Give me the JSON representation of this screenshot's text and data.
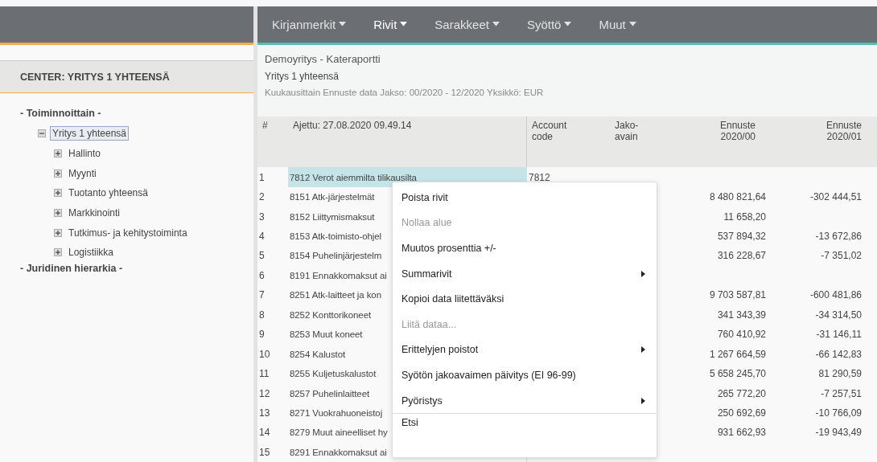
{
  "sidebar": {
    "title": "CENTER: YRITYS 1 YHTEENSÄ",
    "groups": [
      {
        "label": "- Toiminnoittain -",
        "tree": [
          {
            "label": "Yritys 1 yhteensä",
            "expanded": true,
            "selected": true,
            "children": [
              {
                "label": "Hallinto",
                "expanded": false,
                "selected": false
              },
              {
                "label": "Myynti",
                "expanded": false,
                "selected": false
              },
              {
                "label": "Tuotanto yhteensä",
                "expanded": false,
                "selected": false
              },
              {
                "label": "Markkinointi",
                "expanded": false,
                "selected": false
              },
              {
                "label": "Tutkimus- ja kehitystoiminta",
                "expanded": false,
                "selected": false
              },
              {
                "label": "Logistiikka",
                "expanded": false,
                "selected": false
              }
            ]
          }
        ]
      },
      {
        "label": "- Juridinen hierarkia -"
      }
    ]
  },
  "menu_bar": [
    {
      "label": "Kirjanmerkit",
      "selected": false
    },
    {
      "label": "Rivit",
      "selected": true
    },
    {
      "label": "Sarakkeet",
      "selected": false
    },
    {
      "label": "Syöttö",
      "selected": false
    },
    {
      "label": "Muut",
      "selected": false
    }
  ],
  "report": {
    "title": "Demoyritys - Kateraportti",
    "subtitle": "Yritys 1 yhteensä",
    "details": "Kuukausittain Ennuste data Jakso: 00/2020 - 12/2020 Yksikkö: EUR"
  },
  "table": {
    "columns": [
      "#",
      "Ajettu: 27.08.2020 09.49.14",
      "Account\ncode",
      "Jako-\navain",
      "Ennuste\n2020/00",
      "Ennuste\n2020/01"
    ],
    "rows": [
      {
        "num": "1",
        "name": "7812 Verot aiemmilta tilikausilta",
        "code": "7812",
        "v0": "",
        "v1": "",
        "selected": true
      },
      {
        "num": "2",
        "name": "8151 Atk-järjestelmät",
        "code": "",
        "v0": "8 480 821,64",
        "v1": "-302 444,51",
        "selected": false
      },
      {
        "num": "3",
        "name": "8152 Liittymismaksut",
        "code": "",
        "v0": "11 658,20",
        "v1": "",
        "selected": false
      },
      {
        "num": "4",
        "name": "8153 Atk-toimisto-ohjel",
        "code": "",
        "v0": "537 894,32",
        "v1": "-13 672,86",
        "selected": false
      },
      {
        "num": "5",
        "name": "8154 Puhelinjärjestelm",
        "code": "",
        "v0": "316 228,67",
        "v1": "-7 351,02",
        "selected": false
      },
      {
        "num": "6",
        "name": "8191 Ennakkomaksut ai",
        "code": "",
        "v0": "",
        "v1": "",
        "selected": false
      },
      {
        "num": "7",
        "name": "8251 Atk-laitteet ja kon",
        "code": "",
        "v0": "9 703 587,81",
        "v1": "-600 481,86",
        "selected": false
      },
      {
        "num": "8",
        "name": "8252 Konttorikoneet",
        "code": "",
        "v0": "341 343,39",
        "v1": "-34 314,50",
        "selected": false
      },
      {
        "num": "9",
        "name": "8253 Muut koneet",
        "code": "",
        "v0": "760 410,92",
        "v1": "-31 146,11",
        "selected": false
      },
      {
        "num": "10",
        "name": "8254 Kalustot",
        "code": "",
        "v0": "1 267 664,59",
        "v1": "-66 142,83",
        "selected": false
      },
      {
        "num": "11",
        "name": "8255 Kuljetuskalustot",
        "code": "",
        "v0": "5 658 245,70",
        "v1": "81 290,59",
        "selected": false
      },
      {
        "num": "12",
        "name": "8257 Puhelinlaitteet",
        "code": "",
        "v0": "265 772,20",
        "v1": "-7 257,51",
        "selected": false
      },
      {
        "num": "13",
        "name": "8271 Vuokrahuoneistoj",
        "code": "",
        "v0": "250 692,69",
        "v1": "-10 766,09",
        "selected": false
      },
      {
        "num": "14",
        "name": "8279 Muut aineelliset hy",
        "code": "",
        "v0": "931 662,93",
        "v1": "-19 943,49",
        "selected": false
      },
      {
        "num": "15",
        "name": "8291 Ennakkomaksut ai",
        "code": "",
        "v0": "",
        "v1": "",
        "selected": false
      }
    ]
  },
  "context_menu": [
    {
      "label": "Poista rivit",
      "disabled": false,
      "submenu": false,
      "divider_before": false
    },
    {
      "label": "Nollaa alue",
      "disabled": true,
      "submenu": false,
      "divider_before": false
    },
    {
      "label": "Muutos prosenttia +/-",
      "disabled": false,
      "submenu": false,
      "divider_before": false
    },
    {
      "label": "Summarivit",
      "disabled": false,
      "submenu": true,
      "divider_before": false
    },
    {
      "label": "Kopioi data liitettäväksi",
      "disabled": false,
      "submenu": false,
      "divider_before": false
    },
    {
      "label": "Liitä dataa...",
      "disabled": true,
      "submenu": false,
      "divider_before": false
    },
    {
      "label": "Erittelyjen poistot",
      "disabled": false,
      "submenu": true,
      "divider_before": false
    },
    {
      "label": "Syötön jakoavaimen päivitys (EI 96-99)",
      "disabled": false,
      "submenu": false,
      "divider_before": false
    },
    {
      "label": "Pyöristys",
      "disabled": false,
      "submenu": true,
      "divider_before": false
    },
    {
      "label": "Etsi",
      "disabled": false,
      "submenu": false,
      "divider_before": true
    }
  ]
}
